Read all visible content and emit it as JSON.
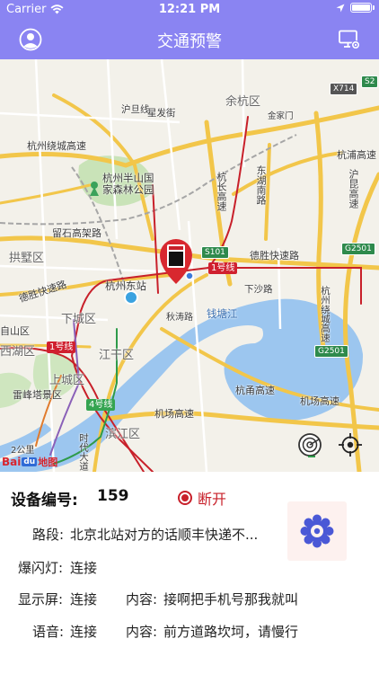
{
  "status_bar": {
    "carrier": "Carrier",
    "time": "12:21 PM"
  },
  "nav": {
    "title": "交通预警"
  },
  "map": {
    "labels": [
      "余杭区",
      "金家门",
      "东湖南路",
      "杭浦高速",
      "沪昆高速",
      "杭州绕城高速",
      "沪旦线",
      "星发街",
      "杭州半山国家森林公园",
      "杭长高速",
      "德胜快速路",
      "留石高架路",
      "拱墅区",
      "杭州东站",
      "秋涛路",
      "下沙路",
      "钱塘江",
      "杭州绕城高速",
      "上城区",
      "西湖区",
      "雷峰塔景区",
      "机场高速",
      "滨江区",
      "杭甬高速",
      "时代大道",
      "下城区",
      "江干区",
      "自山区",
      "德胜快速路"
    ],
    "metro_badges": [
      "1号线",
      "1号线",
      "4号线"
    ],
    "highway_badges": [
      "X714",
      "S2",
      "S101",
      "G2501",
      "G2501"
    ],
    "logo": {
      "a": "Bai",
      "b": "du",
      "c": "地图"
    },
    "scale_text": "2公里"
  },
  "device": {
    "label": "设备编号:",
    "id": "159",
    "connection": "断开",
    "colors": {
      "accent": "#8a84f2",
      "danger": "#c8202a",
      "gear": "#4a58d6"
    }
  },
  "rows": {
    "road": {
      "label": "路段:",
      "value": "北京北站对方的话顺丰快递不..."
    },
    "flash": {
      "label": "爆闪灯:",
      "value": "连接"
    },
    "display": {
      "label": "显示屏:",
      "value": "连接",
      "content_label": "内容:",
      "content": "接啊把手机号那我就叫"
    },
    "voice": {
      "label": "语音:",
      "value": "连接",
      "content_label": "内容:",
      "content": "前方道路坎坷，请慢行"
    }
  }
}
